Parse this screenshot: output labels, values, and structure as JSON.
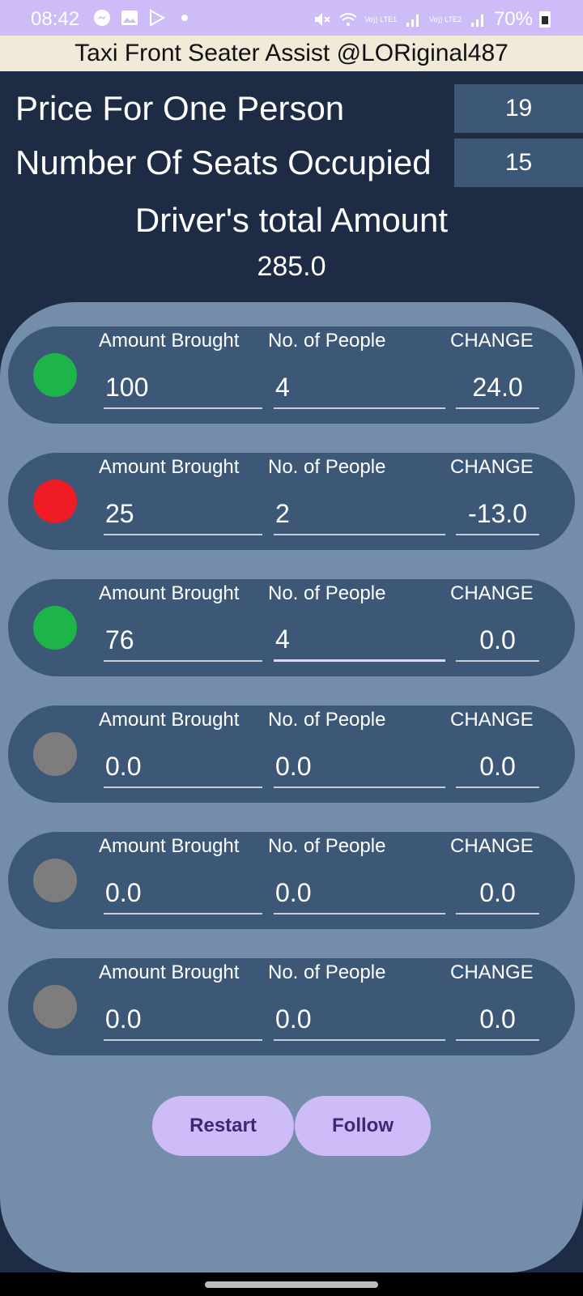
{
  "status_bar": {
    "time": "08:42",
    "sim1_label": "Vo)) LTE1",
    "sim2_label": "Vo)) LTE2",
    "battery": "70%"
  },
  "title_bar": {
    "title": "Taxi Front Seater Assist @LORiginal487"
  },
  "header": {
    "price_label": "Price For One Person",
    "price_value": "19",
    "seats_label": "Number Of Seats Occupied",
    "seats_value": "15",
    "total_title": "Driver's total Amount",
    "total_value": "285.0"
  },
  "labels": {
    "amount": "Amount Brought",
    "people": "No. of People",
    "change": "CHANGE"
  },
  "colors": {
    "green": "#1db54a",
    "red": "#ef1c25",
    "gray": "#7d7d7d",
    "accent": "#cdbcf7"
  },
  "rows": [
    {
      "amount": "100",
      "people": "4",
      "change": "24.0",
      "status": "green"
    },
    {
      "amount": "25",
      "people": "2",
      "change": "-13.0",
      "status": "red"
    },
    {
      "amount": "76",
      "people": "4",
      "change": "0.0",
      "status": "green"
    },
    {
      "amount": "0.0",
      "people": "0.0",
      "change": "0.0",
      "status": "gray"
    },
    {
      "amount": "0.0",
      "people": "0.0",
      "change": "0.0",
      "status": "gray"
    },
    {
      "amount": "0.0",
      "people": "0.0",
      "change": "0.0",
      "status": "gray"
    }
  ],
  "buttons": {
    "restart": "Restart",
    "follow": "Follow"
  }
}
